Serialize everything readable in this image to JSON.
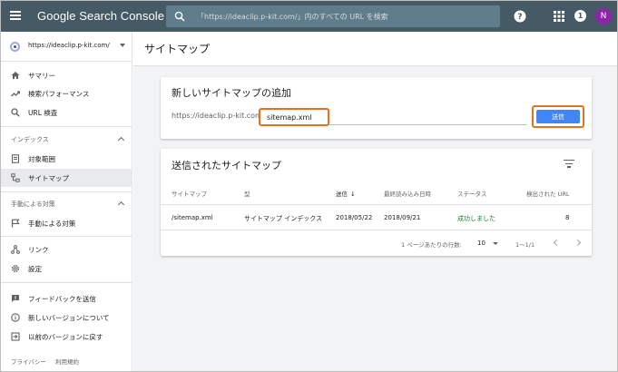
{
  "app": {
    "title": "Google Search Console",
    "search_placeholder": "「https://ideaclip.p-kit.com/」内のすべての URL を検索",
    "notification_count": "1",
    "avatar_initial": "N"
  },
  "sidebar": {
    "property": "https://ideaclip.p-kit.com/",
    "items_top": [
      {
        "label": "サマリー",
        "icon": "home-icon"
      },
      {
        "label": "検索パフォーマンス",
        "icon": "trending-up-icon"
      },
      {
        "label": "URL 検査",
        "icon": "search-icon"
      }
    ],
    "section_index": "インデックス",
    "items_index": [
      {
        "label": "対象範囲",
        "icon": "coverage-icon"
      },
      {
        "label": "サイトマップ",
        "icon": "sitemap-icon",
        "active": true
      }
    ],
    "section_manual": "手動による対策",
    "items_manual": [
      {
        "label": "手動による対策",
        "icon": "flag-icon"
      }
    ],
    "items_misc": [
      {
        "label": "リンク",
        "icon": "links-icon"
      },
      {
        "label": "設定",
        "icon": "settings-icon"
      }
    ],
    "items_bottom": [
      {
        "label": "フィードバックを送信",
        "icon": "feedback-icon"
      },
      {
        "label": "新しいバージョンについて",
        "icon": "info-icon"
      },
      {
        "label": "以前のバージョンに戻す",
        "icon": "exit-icon"
      }
    ],
    "footer": [
      "プライバシー",
      "利用規約"
    ]
  },
  "main": {
    "page_title": "サイトマップ",
    "add_card": {
      "title": "新しいサイトマップの追加",
      "url_prefix": "https://ideaclip.p-kit.com/",
      "input_value": "sitemap.xml",
      "submit_label": "送信"
    },
    "list_card": {
      "title": "送信されたサイトマップ",
      "columns": [
        "サイトマップ",
        "型",
        "送信",
        "最終読み込み日時",
        "ステータス",
        "検出された URL"
      ],
      "rows": [
        [
          "/sitemap.xml",
          "サイトマップ インデックス",
          "2018/05/22",
          "2018/09/21",
          "成功しました",
          "8"
        ]
      ],
      "rows_per_page_label": "1 ページあたりの行数:",
      "rows_per_page": "10",
      "range": "1〜1/1"
    }
  },
  "colors": {
    "topbar": "#455a64",
    "search_bg": "#607d8b",
    "highlight": "#e8711c",
    "primary": "#4285f4",
    "success": "#188038"
  }
}
